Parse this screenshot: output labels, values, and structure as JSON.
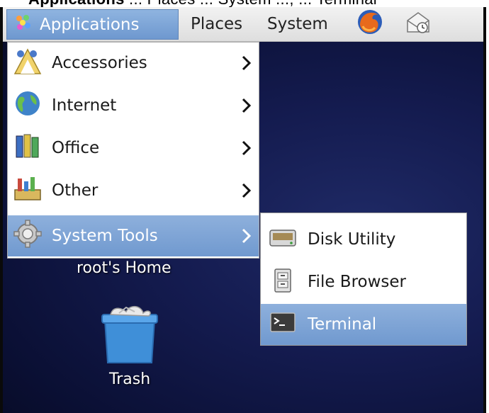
{
  "caption": {
    "bold_text": "Applications",
    "rest_text": " ... Places ... System ..., ... Terminal"
  },
  "panel": {
    "applications_label": "Applications",
    "places_label": "Places",
    "system_label": "System",
    "firefox_icon": "firefox-icon",
    "mail_icon": "mail-clock-icon"
  },
  "menu": {
    "items": [
      {
        "label": "Accessories",
        "icon": "accessories-icon"
      },
      {
        "label": "Internet",
        "icon": "globe-icon"
      },
      {
        "label": "Office",
        "icon": "office-icon"
      },
      {
        "label": "Other",
        "icon": "other-icon"
      },
      {
        "label": "System Tools",
        "icon": "gear-icon"
      }
    ],
    "highlighted_index": 4
  },
  "submenu": {
    "items": [
      {
        "label": "Disk Utility",
        "icon": "disk-icon"
      },
      {
        "label": "File Browser",
        "icon": "file-cabinet-icon"
      },
      {
        "label": "Terminal",
        "icon": "terminal-icon"
      }
    ],
    "highlighted_index": 2
  },
  "desktop": {
    "home_label": "root's Home",
    "trash_label": "Trash"
  },
  "colors": {
    "highlight": "#7ea4d6",
    "desktop_bg": "#141b4f",
    "panel_bg": "#e6e6e6"
  }
}
